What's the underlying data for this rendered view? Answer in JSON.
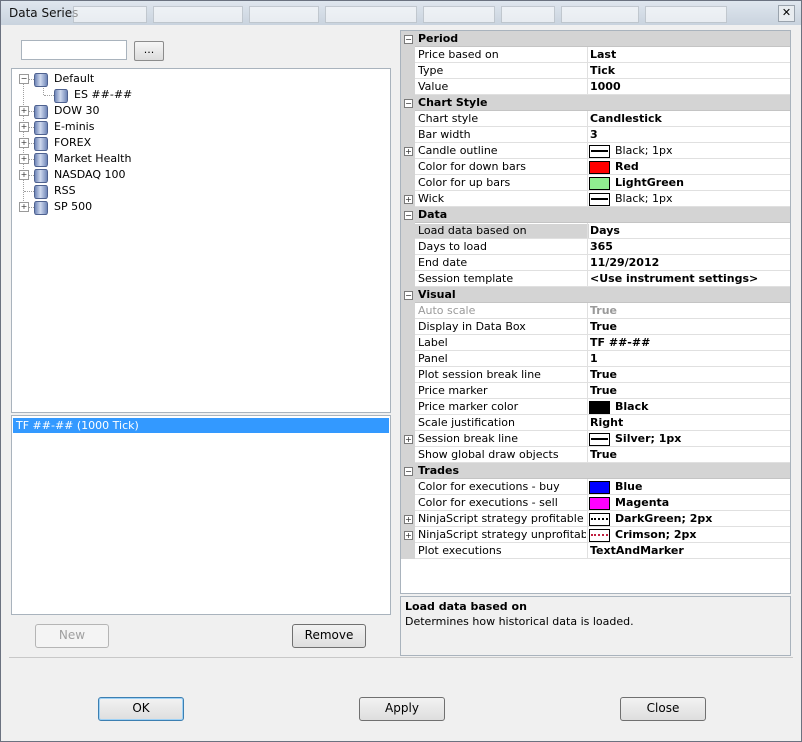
{
  "window": {
    "title": "Data Series",
    "close": "✕"
  },
  "browse_label": "...",
  "tree": [
    {
      "label": "Default",
      "expander": "−"
    },
    {
      "label": "ES ##-##",
      "expander": ""
    },
    {
      "label": "DOW 30",
      "expander": "+"
    },
    {
      "label": "E-minis",
      "expander": "+"
    },
    {
      "label": "FOREX",
      "expander": "+"
    },
    {
      "label": "Market Health",
      "expander": "+"
    },
    {
      "label": "NASDAQ 100",
      "expander": "+"
    },
    {
      "label": "RSS",
      "expander": ""
    },
    {
      "label": "SP 500",
      "expander": "+"
    }
  ],
  "selected_series": "TF ##-## (1000 Tick)",
  "buttons": {
    "new": "New",
    "remove": "Remove",
    "ok": "OK",
    "apply": "Apply",
    "close": "Close"
  },
  "props": [
    {
      "cat": "Period"
    },
    {
      "name": "Price based on",
      "value": "Last"
    },
    {
      "name": "Type",
      "value": "Tick"
    },
    {
      "name": "Value",
      "value": "1000"
    },
    {
      "cat": "Chart Style"
    },
    {
      "name": "Chart style",
      "value": "Candlestick"
    },
    {
      "name": "Bar width",
      "value": "3"
    },
    {
      "name": "Candle outline",
      "value": "Black; 1px",
      "expand": "+"
    },
    {
      "name": "Color for down bars",
      "value": "Red"
    },
    {
      "name": "Color for up bars",
      "value": "LightGreen"
    },
    {
      "name": "Wick",
      "value": "Black; 1px",
      "expand": "+"
    },
    {
      "cat": "Data"
    },
    {
      "name": "Load data based on",
      "value": "Days"
    },
    {
      "name": "Days to load",
      "value": "365"
    },
    {
      "name": "End date",
      "value": "11/29/2012"
    },
    {
      "name": "Session template",
      "value": "<Use instrument settings>"
    },
    {
      "cat": "Visual"
    },
    {
      "name": "Auto scale",
      "value": "True"
    },
    {
      "name": "Display in Data Box",
      "value": "True"
    },
    {
      "name": "Label",
      "value": "TF ##-##"
    },
    {
      "name": "Panel",
      "value": "1"
    },
    {
      "name": "Plot session break line",
      "value": "True"
    },
    {
      "name": "Price marker",
      "value": "True"
    },
    {
      "name": "Price marker color",
      "value": "Black"
    },
    {
      "name": "Scale justification",
      "value": "Right"
    },
    {
      "name": "Session break line",
      "value": "Silver; 1px",
      "expand": "+"
    },
    {
      "name": "Show global draw objects",
      "value": "True"
    },
    {
      "cat": "Trades"
    },
    {
      "name": "Color for executions - buy",
      "value": "Blue"
    },
    {
      "name": "Color for executions - sell",
      "value": "Magenta"
    },
    {
      "name": "NinjaScript strategy profitable trad",
      "value": "DarkGreen; 2px",
      "expand": "+"
    },
    {
      "name": "NinjaScript strategy unprofitable tr",
      "value": "Crimson; 2px",
      "expand": "+"
    },
    {
      "name": "Plot executions",
      "value": "TextAndMarker"
    }
  ],
  "colors": {
    "red": "#ff0000",
    "lightgreen": "#90ee90",
    "black": "#000000",
    "blue": "#0000ff",
    "magenta": "#ff00ff",
    "selection": "#3399ff"
  },
  "description": {
    "title": "Load data based on",
    "text": "Determines how historical data is loaded."
  }
}
